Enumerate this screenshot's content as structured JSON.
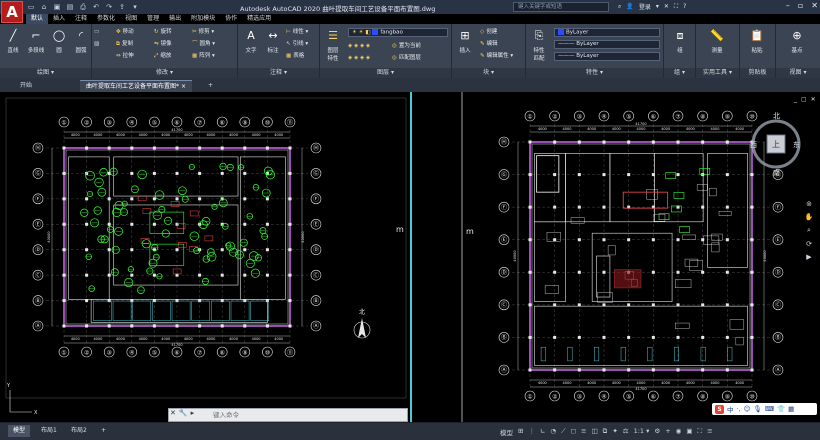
{
  "window": {
    "title": "Autodesk AutoCAD 2020    曲叶提取车间工艺设备平面布置图.dwg",
    "search_placeholder": "键入关键字或短语",
    "login": "登录",
    "logo_letter": "A"
  },
  "ribbon_tabs": [
    "默认",
    "插入",
    "注释",
    "参数化",
    "视图",
    "管理",
    "输出",
    "附加模块",
    "协作",
    "精选应用"
  ],
  "panels": {
    "draw": {
      "title": "绘图 ▾",
      "line": "直线",
      "polyline": "多段线",
      "circle": "圆",
      "arc": "圆弧"
    },
    "modify": {
      "title": "修改 ▾",
      "move": "移动",
      "rotate": "旋转",
      "trim": "修剪 ▾",
      "copy": "复制",
      "mirror": "镜像",
      "fillet": "圆角 ▾",
      "stretch": "拉伸",
      "scale": "缩放",
      "array": "阵列 ▾"
    },
    "annotation": {
      "title": "注释 ▾",
      "text": "文字",
      "dim": "标注",
      "linear": "线性 ▾",
      "leader": "引线 ▾",
      "table": "表格"
    },
    "layers": {
      "title": "图层 ▾",
      "props": "图层\n特性",
      "current_layer": "fangbao",
      "make_current": "置为当前",
      "match": "匹配图层"
    },
    "block": {
      "title": "块 ▾",
      "insert": "插入",
      "create": "创建",
      "edit": "编辑",
      "edit_attr": "编辑属性 ▾"
    },
    "properties": {
      "title": "特性 ▾",
      "match": "特性\n匹配",
      "bylayer1": "ByLayer",
      "bylayer2": "ByLayer",
      "bylayer3": "ByLayer"
    },
    "groups": {
      "title": "组 ▾",
      "group": "组"
    },
    "utilities": {
      "title": "实用工具 ▾",
      "measure": "测量"
    },
    "clipboard": {
      "title": "剪贴板",
      "paste": "粘贴"
    },
    "view": {
      "title": "视图 ▾",
      "base": "基点"
    }
  },
  "doc_tabs": {
    "start": "开始",
    "drawing": "曲叶提取车间工艺设备平面布置图*",
    "close": "×",
    "add": "+"
  },
  "viewcube": {
    "north": "北",
    "south": "南",
    "east": "东",
    "west": "西",
    "top": "上",
    "wcs": "WCS ▾"
  },
  "viewport_controls": [
    "_",
    "▢",
    "✕"
  ],
  "command_placeholder": "键入命令",
  "status": {
    "model": "模型",
    "layout1": "布局1",
    "layout2": "布局2",
    "model_label": "模型",
    "scale": "1:1 ▾"
  },
  "ime": {
    "s": "S",
    "text": "中"
  },
  "plan": {
    "left_columns": [
      "①",
      "②",
      "③",
      "④",
      "⑤",
      "⑥",
      "⑦",
      "⑧",
      "⑨",
      "⑩",
      "⑪"
    ],
    "left_rows": [
      "Ⓗ",
      "Ⓖ",
      "Ⓕ",
      "Ⓔ",
      "Ⓓ",
      "Ⓒ",
      "Ⓑ",
      "Ⓐ"
    ],
    "right_columns": [
      "①",
      "②",
      "③",
      "④",
      "⑤",
      "⑥",
      "⑦",
      "⑧",
      "⑨",
      "⑩"
    ],
    "right_rows": [
      "Ⓗ",
      "Ⓖ",
      "Ⓕ",
      "Ⓔ",
      "Ⓓ",
      "Ⓒ",
      "Ⓑ",
      "Ⓐ"
    ],
    "dim_total": "41700",
    "dim_bay": "4000",
    "dim_side": "40000",
    "north": "北",
    "left_mark": "m",
    "right_mark": "m"
  }
}
